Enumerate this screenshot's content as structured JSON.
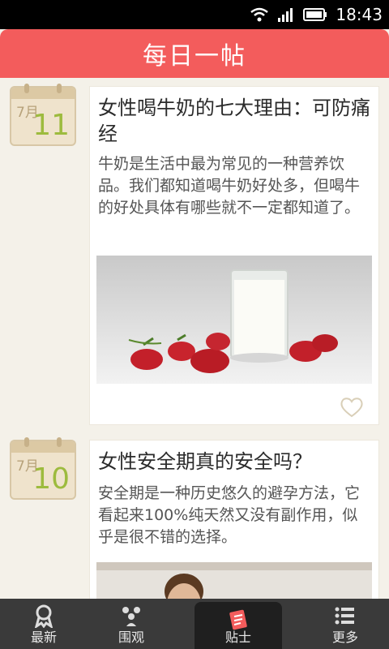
{
  "status": {
    "time": "18:43"
  },
  "header": {
    "title": "每日一帖"
  },
  "posts": [
    {
      "month": "7月",
      "day": "11",
      "title": "女性喝牛奶的七大理由：可防痛经",
      "summary": "牛奶是生活中最为常见的一种营养饮品。我们都知道喝牛奶好处多，但喝牛的好处具体有哪些就不一定都知道了。",
      "image": "glass-of-milk-with-strawberries"
    },
    {
      "month": "7月",
      "day": "10",
      "title": "女性安全期真的安全吗？",
      "summary": "安全期是一种历史悠久的避孕方法，它看起来100%纯天然又没有副作用，似乎是很不错的选择。",
      "image": "man-portrait"
    }
  ],
  "tabs": [
    {
      "label": "最新",
      "icon": "ribbon-icon"
    },
    {
      "label": "围观",
      "icon": "crowd-icon"
    },
    {
      "label": "贴士",
      "icon": "notes-icon",
      "active": true
    },
    {
      "label": "更多",
      "icon": "list-icon"
    }
  ],
  "colors": {
    "header": "#f35c5c",
    "tabbar": "#3a3a3a",
    "day": "#9dbb3e",
    "background": "#f4f1e9"
  }
}
